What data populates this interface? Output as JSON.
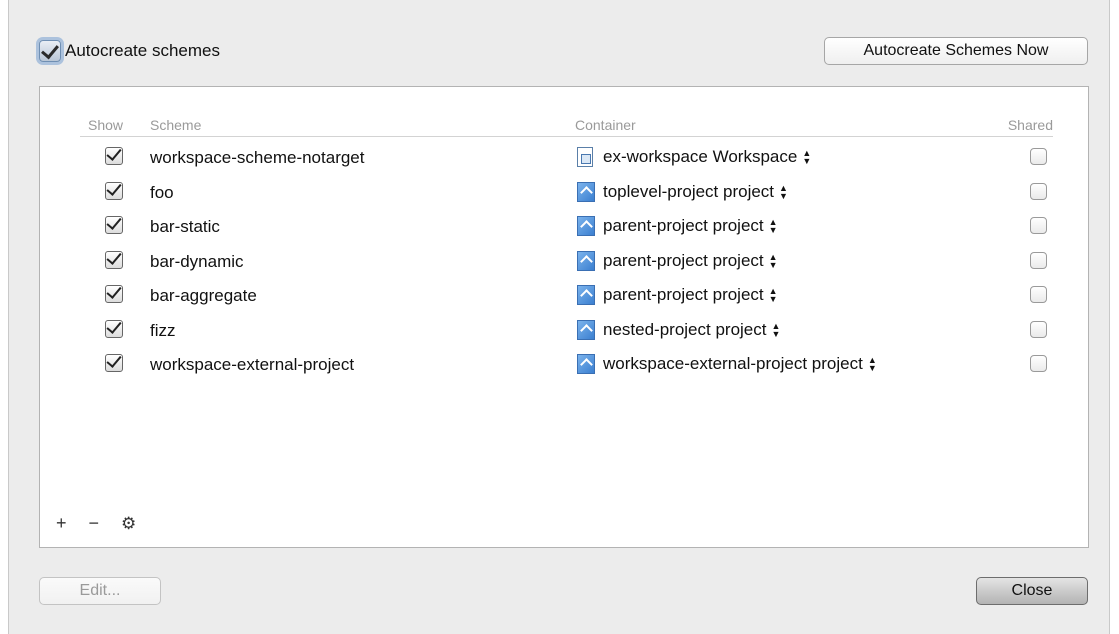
{
  "autocreate": {
    "label": "Autocreate schemes",
    "checked": true
  },
  "buttons": {
    "autocreate_now": "Autocreate Schemes Now",
    "edit": "Edit...",
    "close": "Close"
  },
  "table": {
    "columns": {
      "show": "Show",
      "scheme": "Scheme",
      "container": "Container",
      "shared": "Shared"
    },
    "rows": [
      {
        "show": true,
        "scheme": "workspace-scheme-notarget",
        "container": "ex-workspace Workspace",
        "container_icon": "workspace-file-icon",
        "shared": false
      },
      {
        "show": true,
        "scheme": "foo",
        "container": "toplevel-project project",
        "container_icon": "xcode-project-icon",
        "shared": false
      },
      {
        "show": true,
        "scheme": "bar-static",
        "container": "parent-project project",
        "container_icon": "xcode-project-icon",
        "shared": false
      },
      {
        "show": true,
        "scheme": "bar-dynamic",
        "container": "parent-project project",
        "container_icon": "xcode-project-icon",
        "shared": false
      },
      {
        "show": true,
        "scheme": "bar-aggregate",
        "container": "parent-project project",
        "container_icon": "xcode-project-icon",
        "shared": false
      },
      {
        "show": true,
        "scheme": "fizz",
        "container": "nested-project project",
        "container_icon": "xcode-project-icon",
        "shared": false
      },
      {
        "show": true,
        "scheme": "workspace-external-project",
        "container": "workspace-external-project project",
        "container_icon": "xcode-project-icon",
        "shared": false
      }
    ]
  },
  "tools": {
    "add": "+",
    "remove": "−",
    "gear": "⚙"
  },
  "colors": {
    "background": "#ececec",
    "panel": "#ffffff",
    "header_text": "#9a9a9a",
    "focus_ring": "#78a0d2"
  }
}
